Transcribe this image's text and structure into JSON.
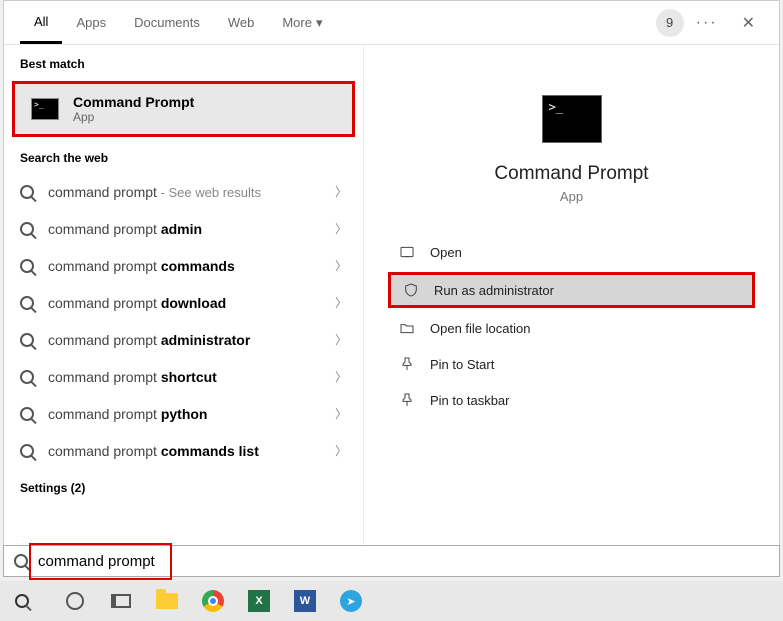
{
  "tabs": {
    "all": "All",
    "apps": "Apps",
    "documents": "Documents",
    "web": "Web",
    "more": "More"
  },
  "header": {
    "badge": "9"
  },
  "sections": {
    "best_match": "Best match",
    "search_web": "Search the web",
    "settings": "Settings (2)"
  },
  "best_match": {
    "title": "Command Prompt",
    "subtitle": "App"
  },
  "web_items": [
    {
      "prefix": "command prompt",
      "bold": "",
      "suffix": " - See web results"
    },
    {
      "prefix": "command prompt ",
      "bold": "admin",
      "suffix": ""
    },
    {
      "prefix": "command prompt ",
      "bold": "commands",
      "suffix": ""
    },
    {
      "prefix": "command prompt ",
      "bold": "download",
      "suffix": ""
    },
    {
      "prefix": "command prompt ",
      "bold": "administrator",
      "suffix": ""
    },
    {
      "prefix": "command prompt ",
      "bold": "shortcut",
      "suffix": ""
    },
    {
      "prefix": "command prompt ",
      "bold": "python",
      "suffix": ""
    },
    {
      "prefix": "command prompt ",
      "bold": "commands list",
      "suffix": ""
    }
  ],
  "preview": {
    "title": "Command Prompt",
    "subtitle": "App"
  },
  "actions": {
    "open": "Open",
    "run_admin": "Run as administrator",
    "open_loc": "Open file location",
    "pin_start": "Pin to Start",
    "pin_taskbar": "Pin to taskbar"
  },
  "search": {
    "value": "command prompt"
  }
}
